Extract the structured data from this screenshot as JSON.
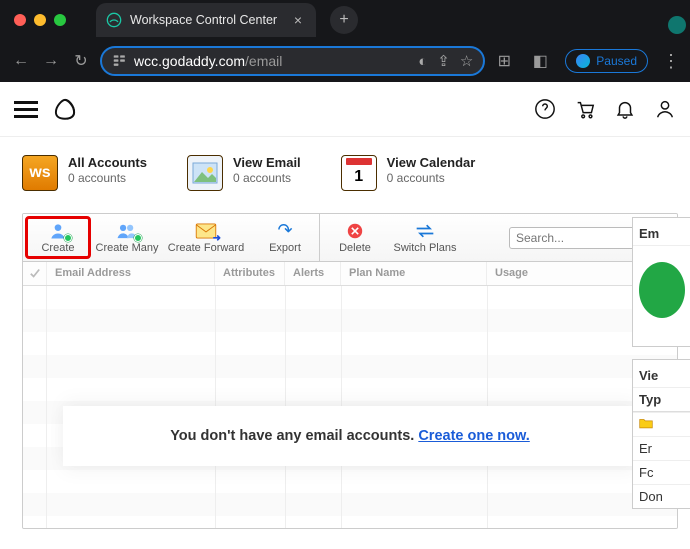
{
  "browser": {
    "tab_title": "Workspace Control Center",
    "new_tab_tip": "New Tab",
    "url_domain": "wcc.godaddy.com",
    "url_path": "/email",
    "paused_label": "Paused",
    "nav": {
      "back": "←",
      "forward": "→",
      "reload": "↻"
    },
    "share_icon": "⇪",
    "eye_off": "◐",
    "star": "☆",
    "ext": "⊞",
    "sidepanel": "◧",
    "menu": "⋮"
  },
  "site_header": {
    "help_tip": "Help",
    "cart_tip": "Cart",
    "bell_tip": "Notifications",
    "account_tip": "Account"
  },
  "summary": {
    "items": [
      {
        "title": "All Accounts",
        "sub": "0 accounts",
        "icon": "ws"
      },
      {
        "title": "View Email",
        "sub": "0 accounts",
        "icon": "view-email"
      },
      {
        "title": "View Calendar",
        "sub": "0 accounts",
        "icon": "cal"
      }
    ]
  },
  "toolbar": {
    "create": "Create",
    "create_many": "Create Many",
    "create_forward": "Create Forward",
    "export": "Export",
    "delete": "Delete",
    "switch_plans": "Switch Plans",
    "search_placeholder": "Search..."
  },
  "grid": {
    "cols": {
      "email": "Email Address",
      "attributes": "Attributes",
      "alerts": "Alerts",
      "plan": "Plan Name",
      "usage": "Usage"
    },
    "rows": []
  },
  "empty": {
    "msg": "You don't have any email accounts.",
    "link": "Create one now."
  },
  "side": {
    "card1_hd": "Em",
    "card2_hd": "Vie",
    "card2_type_hd": "Typ",
    "card2_rows": [
      "Er",
      "Fc",
      "Don"
    ]
  },
  "colors": {
    "highlight": "#e60000",
    "link": "#1a5cd8"
  }
}
